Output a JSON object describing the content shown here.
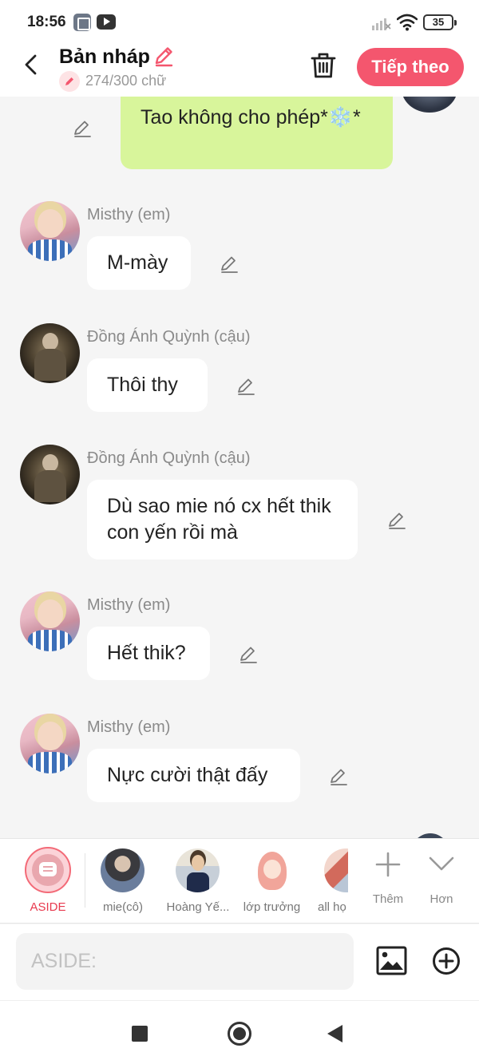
{
  "status_bar": {
    "time": "18:56",
    "battery": "35"
  },
  "header": {
    "title": "Bản nháp",
    "word_count": "274/300 chữ",
    "next_button": "Tiếp theo"
  },
  "messages": [
    {
      "sender": "",
      "text": "Tao không cho phép*❄️*",
      "side": "right"
    },
    {
      "sender": "Misthy (em)",
      "text": "M-mày",
      "side": "left"
    },
    {
      "sender": "Đồng Ánh Quỳnh (cậu)",
      "text": "Thôi thy",
      "side": "left"
    },
    {
      "sender": "Đồng Ánh Quỳnh (cậu)",
      "text": "Dù sao mie nó cx hết thik con yến rồi mà",
      "side": "left"
    },
    {
      "sender": "Misthy (em)",
      "text": "Hết thik?",
      "side": "left"
    },
    {
      "sender": "Misthy (em)",
      "text": "Nực cười thật đấy",
      "side": "left"
    }
  ],
  "characters": [
    {
      "label": "ASIDE",
      "selected": true
    },
    {
      "label": "mie(cô)"
    },
    {
      "label": "Hoàng Yế..."
    },
    {
      "label": "lớp trưởng"
    },
    {
      "label": "all họ"
    }
  ],
  "char_actions": {
    "more": "Thêm",
    "less": "Hơn"
  },
  "composer": {
    "placeholder": "ASIDE:"
  },
  "colors": {
    "accent": "#f4566e",
    "self_bubble": "#d8f59b"
  }
}
